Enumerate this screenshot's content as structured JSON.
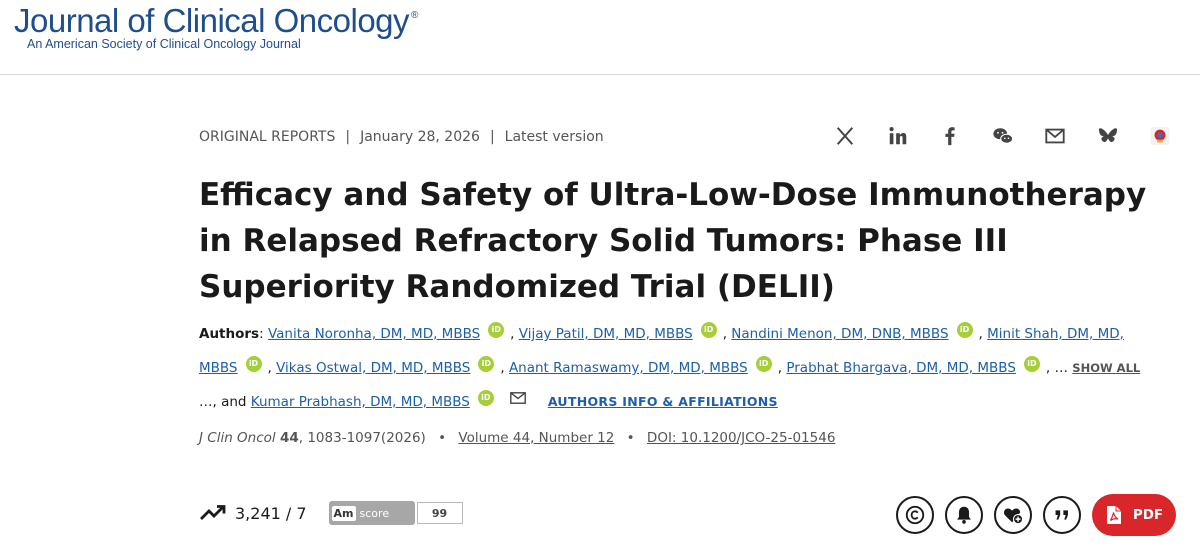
{
  "header": {
    "logo_main": "Journal of Clinical Oncology",
    "logo_reg": "®",
    "logo_sub": "An American Society of Clinical Oncology Journal"
  },
  "article_meta": {
    "type": "ORIGINAL REPORTS",
    "date": "January 28, 2026",
    "version": "Latest version",
    "separator": "|"
  },
  "share_icons": [
    "x-icon",
    "linkedin-icon",
    "facebook-icon",
    "wechat-icon",
    "email-icon",
    "bluesky-icon",
    "mendeley-icon"
  ],
  "title": "Efficacy and Safety of Ultra-Low-Dose Immunotherapy in Relapsed Refractory Solid Tumors: Phase III Superiority Randomized Trial (DELII)",
  "authors": {
    "label": "Authors",
    "list": [
      "Vanita Noronha, DM, MD, MBBS",
      "Vijay Patil, DM, MD, MBBS",
      "Nandini Menon, DM, DNB, MBBS",
      "Minit Shah, DM, MD, MBBS",
      "Vikas Ostwal, DM, MD, MBBS",
      "Anant Ramaswamy, DM, MD, MBBS",
      "Prabhat Bhargava, DM, MD, MBBS",
      "Kumar Prabhash, DM, MD, MBBS"
    ],
    "orcid_label": "iD",
    "show_all": "SHOW ALL",
    "ellipsis": "…",
    "and_text": ", and",
    "affiliations": "AUTHORS INFO & AFFILIATIONS"
  },
  "citation": {
    "journal": "J Clin Oncol",
    "volume_bold": "44",
    "pages": ", 1083-1097(2026)",
    "volume_link": "Volume 44, Number 12",
    "doi": "DOI: 10.1200/JCO-25-01546",
    "bullet": "•"
  },
  "metrics": {
    "views": "3,241 / 7",
    "altmetric_label": "Am",
    "altmetric_score_label": "score",
    "altmetric_score": "99"
  },
  "actions": {
    "pdf_label": "PDF"
  },
  "colors": {
    "brand": "#1f4e8c",
    "link": "#1d5fa8",
    "pdf": "#d9262b",
    "orcid": "#a6ce39"
  }
}
